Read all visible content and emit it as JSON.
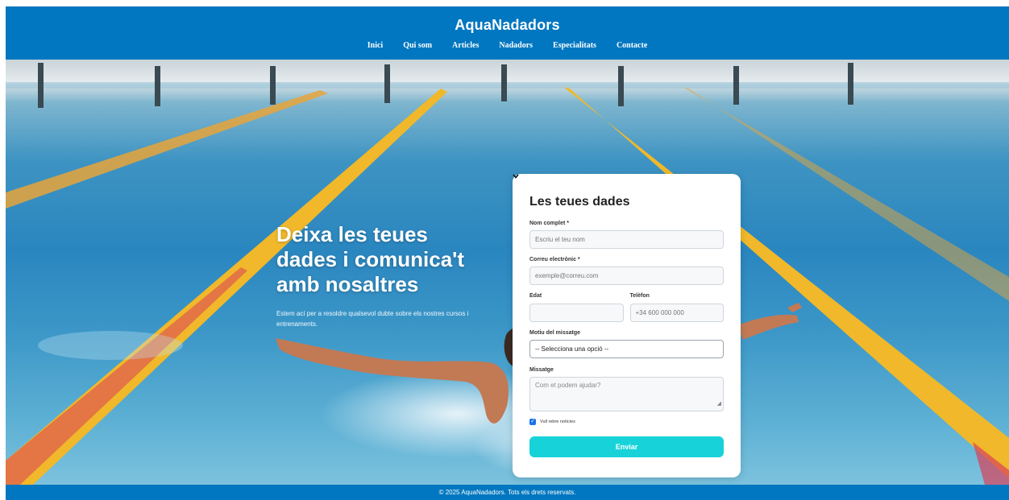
{
  "header": {
    "brand": "AquaNadadors",
    "nav": [
      "Inici",
      "Qui som",
      "Articles",
      "Nadadors",
      "Especialitats",
      "Contacte"
    ]
  },
  "hero": {
    "title": "Deixa les teues dades i comunica't amb nosaltres",
    "subtitle": "Estem ací per a resoldre qualsevol dubte sobre els nostres cursos i entrenaments."
  },
  "form": {
    "title": "Les teues dades",
    "name": {
      "label": "Nom complet *",
      "placeholder": "Escriu el teu nom",
      "value": ""
    },
    "email": {
      "label": "Correu electrònic *",
      "placeholder": "exemple@correu.com",
      "value": ""
    },
    "age": {
      "label": "Edat",
      "placeholder": "",
      "value": ""
    },
    "phone": {
      "label": "Telèfon",
      "placeholder": "+34 600 000 000",
      "value": ""
    },
    "reason": {
      "label": "Motiu del missatge",
      "selected": "-- Selecciona una opció --"
    },
    "message": {
      "label": "Missatge",
      "placeholder": "Com et podem ajudar?",
      "value": ""
    },
    "newsletter": {
      "label": "Vull rebre notícies",
      "checked": true
    },
    "submit_label": "Enviar"
  },
  "footer": {
    "text": "© 2025 AquaNadadors. Tots els drets reservats."
  },
  "colors": {
    "header": "#0077c0",
    "submit": "#17d3d9",
    "checkbox": "#1a73e8"
  },
  "icons": {
    "select_arrow": "chevron-down-icon",
    "checkbox": "check-icon"
  }
}
